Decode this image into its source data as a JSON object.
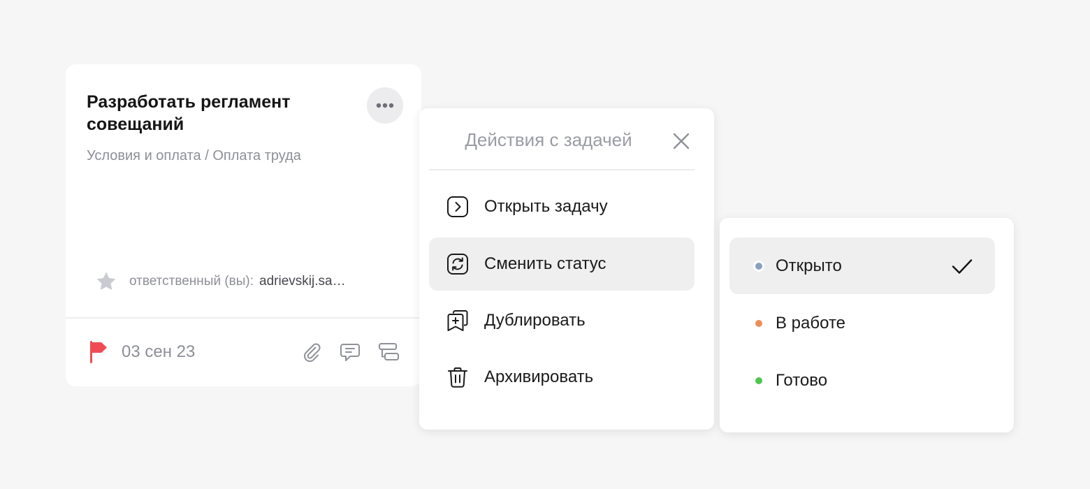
{
  "card": {
    "title": "Разработать регламент совещаний",
    "path": "Условия и оплата / Оплата труда",
    "assignee_label": "ответственный (вы):",
    "assignee_name": "adrievskij.sa…",
    "due_date": "03 сен 23",
    "icons": {
      "more": "more-dots-icon",
      "star": "star-icon",
      "flag": "flag-icon",
      "attach": "paperclip-icon",
      "comment": "comment-icon",
      "subtasks": "subtasks-icon"
    }
  },
  "actions_menu": {
    "title": "Действия с задачей",
    "items": [
      {
        "label": "Открыть задачу",
        "icon": "open-task-icon",
        "active": false
      },
      {
        "label": "Сменить статус",
        "icon": "change-status-icon",
        "active": true
      },
      {
        "label": "Дублировать",
        "icon": "duplicate-icon",
        "active": false
      },
      {
        "label": "Архивировать",
        "icon": "trash-icon",
        "active": false
      }
    ]
  },
  "status_menu": {
    "items": [
      {
        "label": "Открыто",
        "color": "#8aa0bf",
        "selected": true
      },
      {
        "label": "В работе",
        "color": "#ec8d58",
        "selected": false
      },
      {
        "label": "Готово",
        "color": "#4fc552",
        "selected": false
      }
    ]
  },
  "colors": {
    "background": "#f6f6f6",
    "flag": "#f04b55",
    "active_row": "#efeff0",
    "muted_text": "#8d8f96"
  }
}
